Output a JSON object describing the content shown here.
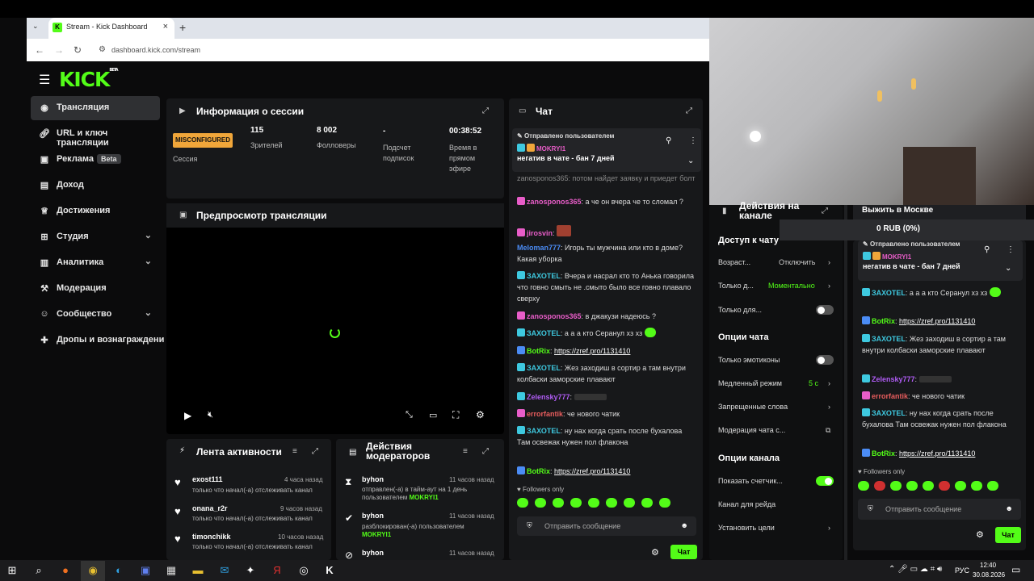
{
  "browser": {
    "tab_title": "Stream - Kick Dashboard",
    "new_tab": "+",
    "url": "dashboard.kick.com/stream"
  },
  "sidebar": {
    "logo": "KICK",
    "logo_beta": "BETA",
    "items": [
      {
        "label": "Трансляция",
        "icon": "broadcast-icon"
      },
      {
        "label": "URL и ключ трансляции",
        "icon": "link-icon"
      },
      {
        "label": "Реклама",
        "badge": "Beta",
        "icon": "ad-icon"
      },
      {
        "label": "Доход",
        "icon": "income-icon"
      },
      {
        "label": "Достижения",
        "icon": "trophy-icon"
      },
      {
        "label": "Студия",
        "icon": "studio-icon"
      },
      {
        "label": "Аналитика",
        "icon": "chart-icon"
      },
      {
        "label": "Модерация",
        "icon": "hammer-icon"
      },
      {
        "label": "Сообщество",
        "icon": "community-icon"
      },
      {
        "label": "Дропы и вознаграждени",
        "icon": "gift-icon"
      }
    ]
  },
  "session": {
    "title": "Информация о сессии",
    "status": "MISCONFIGURED",
    "status_label": "Сессия",
    "stats": [
      {
        "value": "115",
        "label": "Зрителей"
      },
      {
        "value": "8 002",
        "label": "Фолловеры"
      },
      {
        "value": "-",
        "label": "Подсчет подписок"
      },
      {
        "value": "00:38:52",
        "label": "Время в прямом эфире"
      }
    ]
  },
  "preview": {
    "title": "Предпросмотр трансляции"
  },
  "activity": {
    "title": "Лента активности",
    "items": [
      {
        "user": "exost111",
        "time": "4 часа назад",
        "text": "только что начал(-а) отслеживать канал"
      },
      {
        "user": "onana_r2r",
        "time": "9 часов назад",
        "text": "только что начал(-а) отслеживать канал"
      },
      {
        "user": "timonchikk",
        "time": "10 часов назад",
        "text": "только что начал(-а) отслеживать канал"
      }
    ]
  },
  "modactions": {
    "title": "Действия модераторов",
    "items": [
      {
        "user": "byhon",
        "time": "11 часов назад",
        "text": "отправлен(-а) в тайм-аут на 1 день пользователем",
        "target": "MOKRYI1"
      },
      {
        "user": "byhon",
        "time": "11 часов назад",
        "text": "разблокирован(-а) пользователем",
        "target": "MOKRYI1"
      },
      {
        "user": "byhon",
        "time": "11 часов назад",
        "text": "",
        "target": ""
      }
    ]
  },
  "chat": {
    "title": "Чат",
    "pinned_by": "Отправлено пользователем",
    "pinned_user": "MOKRYI1",
    "pinned_text": "негатив в чате - бан 7 дней",
    "partial": "zanosponos365: потом найдет заявку и приедет болт",
    "messages": [
      {
        "user": "zanosponos365",
        "color": "#e85dc8",
        "text": "а че он вчера че то сломал ?"
      },
      {
        "user": "jirosvin",
        "color": "#e85dc8",
        "text": ""
      },
      {
        "user": "Meloman777",
        "color": "#4b8cf5",
        "text": "Игорь ты мужчина или кто в доме? Какая уборка"
      },
      {
        "user": "ЗАХОТЕL",
        "color": "#3ec9e0",
        "text": "Вчера и насрал кто то Анька говорила что говно смыть не .смыто было все говно плавало сверху"
      },
      {
        "user": "zanosponos365",
        "color": "#e85dc8",
        "text": "в джакузи надеюсь ?"
      },
      {
        "user": "ЗАХОТЕL",
        "color": "#3ec9e0",
        "text": "а а а кто Серанул хз хз"
      },
      {
        "user": "BotRix",
        "color": "#53fc18",
        "text": "https://zref.pro/1131410",
        "link": true
      },
      {
        "user": "ЗАХОТЕL",
        "color": "#3ec9e0",
        "text": "Жез заходиш в сортир а там внутри колбаски заморские плавают"
      },
      {
        "user": "Zelensky777",
        "color": "#b05cf5",
        "text": ""
      },
      {
        "user": "errorfantik",
        "color": "#e85d5d",
        "text": "че нового чатик"
      },
      {
        "user": "ЗАХОТЕL",
        "color": "#3ec9e0",
        "text": "ну нах когда срать после бухалова Там освежак нужен пол флакона"
      },
      {
        "user": "BotRix",
        "color": "#53fc18",
        "text": "https://zref.pro/1131410",
        "link": true
      }
    ],
    "followers_only": "Followers only",
    "placeholder": "Отправить сообщение",
    "send": "Чат"
  },
  "modpanel": {
    "title": "Действия на канале",
    "section_chat_access": "Доступ к чату",
    "rows_access": [
      {
        "label": "Возраст...",
        "value": "Отключить"
      },
      {
        "label": "Только д...",
        "value": "Моментально"
      },
      {
        "label": "Только для...",
        "toggle": false
      }
    ],
    "section_chat_opts": "Опции чата",
    "rows_opts": [
      {
        "label": "Только эмотиконы",
        "toggle": false
      },
      {
        "label": "Медленный режим",
        "value": "5 с"
      },
      {
        "label": "Запрещенные слова",
        "value": ""
      },
      {
        "label": "Модерация чата с...",
        "value": ""
      }
    ],
    "section_channel": "Опции канала",
    "rows_channel": [
      {
        "label": "Показать счетчик...",
        "toggle": true
      },
      {
        "label": "Канал для рейда",
        "value": ""
      },
      {
        "label": "Установить цели",
        "value": ""
      }
    ]
  },
  "goal": {
    "title": "Выжить в Москве",
    "amount": "0 RUB (0%)"
  },
  "chat2": {
    "pinned_by": "Отправлено пользователем",
    "pinned_user": "MOKRYI1",
    "pinned_text": "негатив в чате - бан 7 дней",
    "messages": [
      {
        "user": "ЗАХОТЕL",
        "color": "#3ec9e0",
        "text": "а а а кто Серанул хз хз"
      },
      {
        "user": "BotRix",
        "color": "#53fc18",
        "text": "https://zref.pro/1131410",
        "link": true
      },
      {
        "user": "ЗАХОТЕL",
        "color": "#3ec9e0",
        "text": "Жез заходиш в сортир а там внутри колбаски заморские плавают"
      },
      {
        "user": "Zelensky777",
        "color": "#b05cf5",
        "text": ""
      },
      {
        "user": "errorfantik",
        "color": "#e85d5d",
        "text": "че нового чатик"
      },
      {
        "user": "ЗАХОТЕL",
        "color": "#3ec9e0",
        "text": "ну нах когда срать после бухалова Там освежак нужен пол флакона"
      },
      {
        "user": "BotRix",
        "color": "#53fc18",
        "text": "https://zref.pro/1131410",
        "link": true
      }
    ],
    "followers_only": "Followers only",
    "placeholder": "Отправить сообщение",
    "send": "Чат"
  },
  "taskbar": {
    "lang": "РУС",
    "time": "12:40",
    "date": "30.08.2026"
  },
  "colors": {
    "accent": "#53fc18",
    "panel": "#17181a",
    "bg": "#0b0b0c",
    "warning": "#f0a63a"
  }
}
